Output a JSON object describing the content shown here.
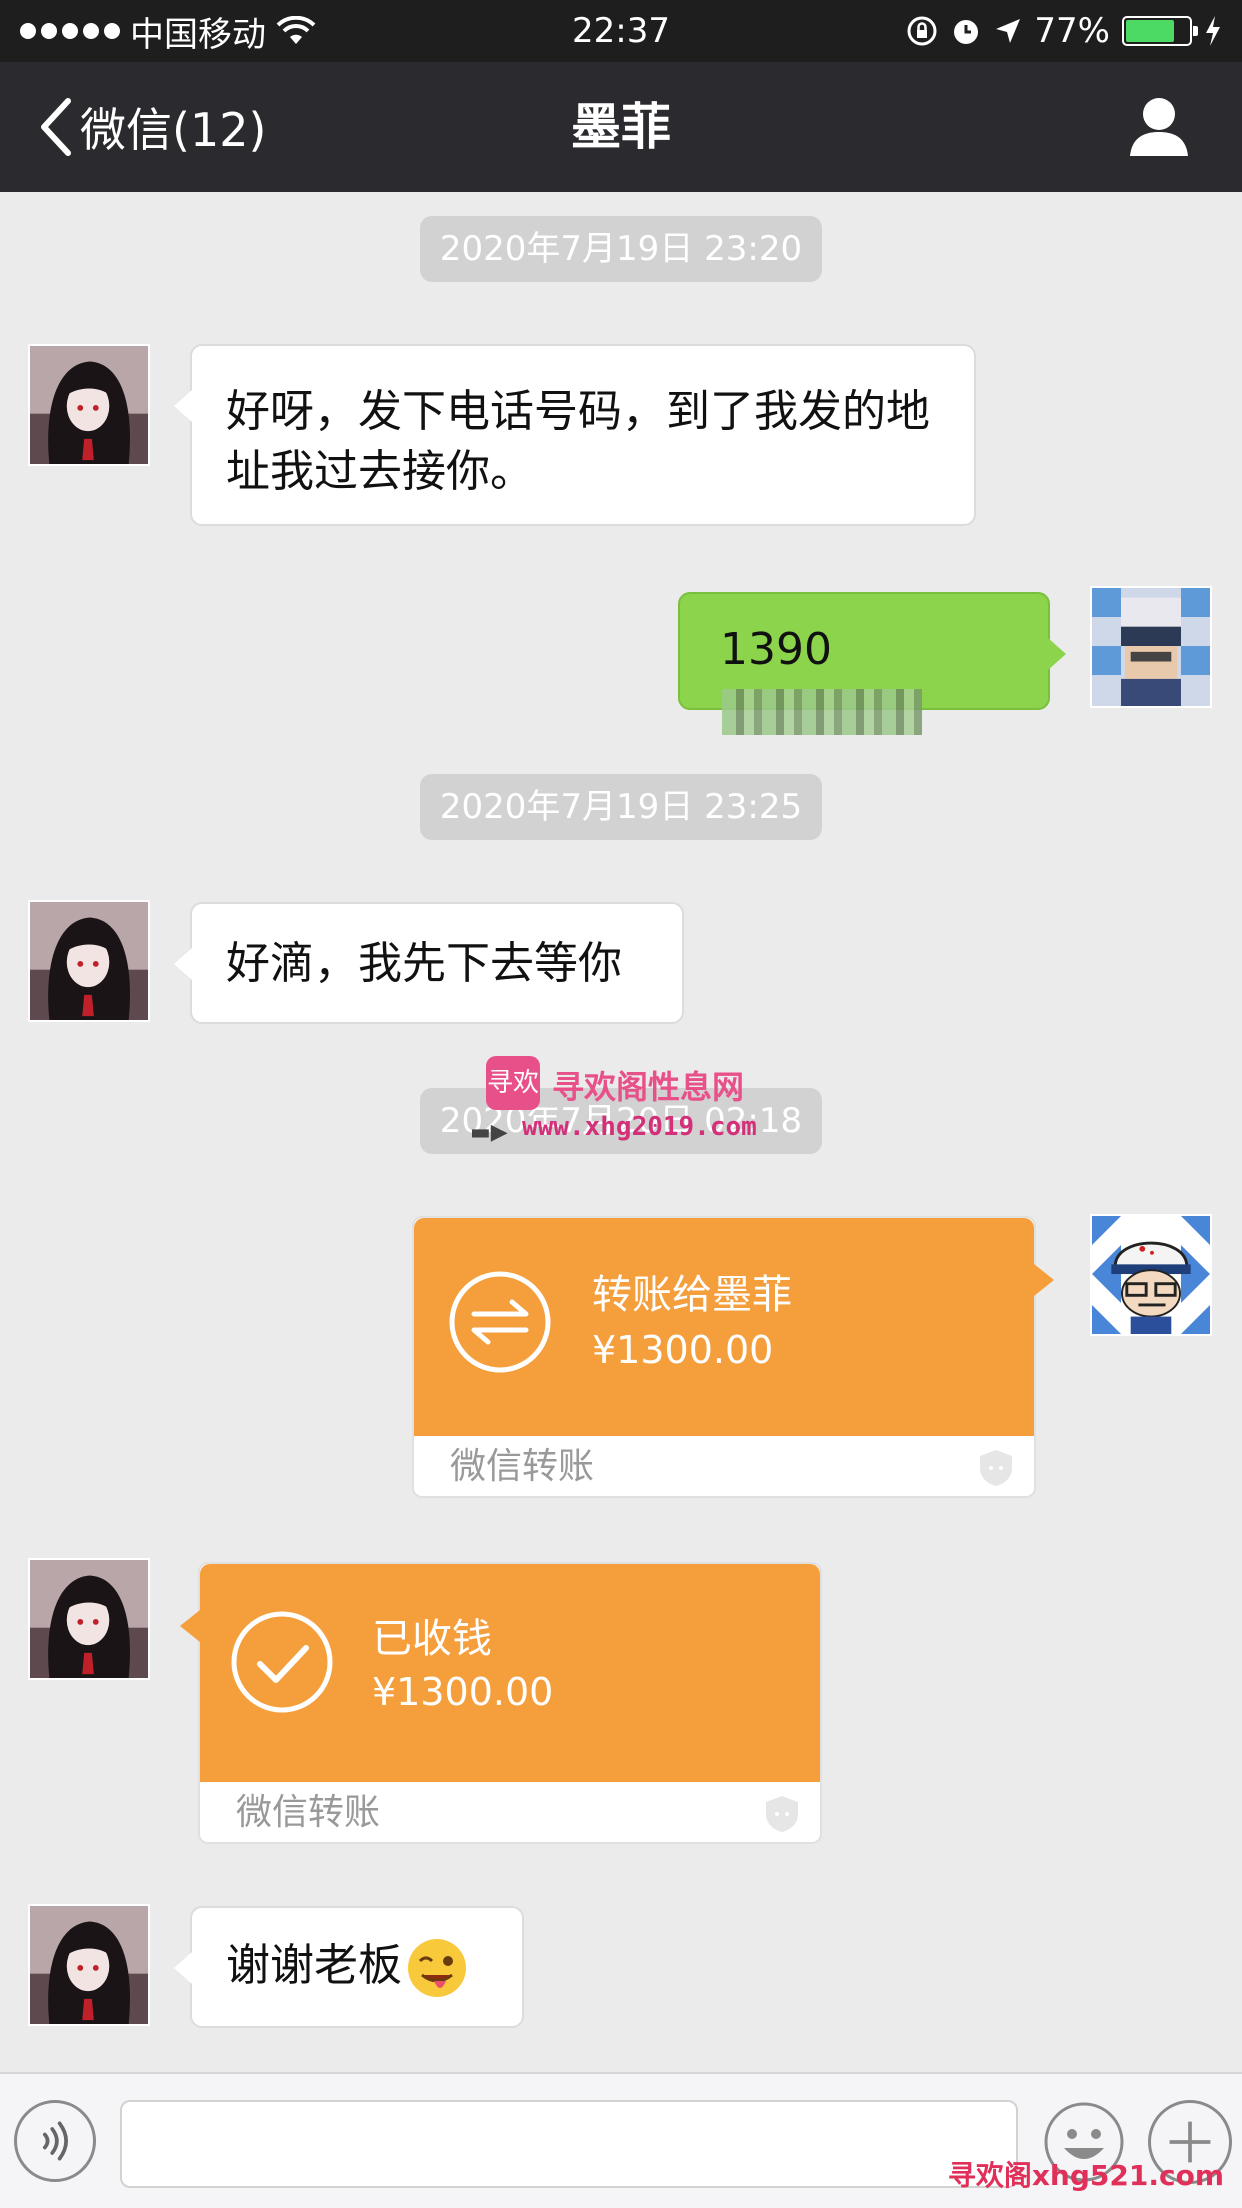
{
  "status_bar": {
    "carrier": "中国移动",
    "time": "22:37",
    "battery": "77%",
    "battery_level": 0.77
  },
  "nav": {
    "back_label": "微信(12)",
    "title": "墨菲"
  },
  "messages": {
    "time_1": "2020年7月19日 23:20",
    "msg_1": "好呀，发下电话号码，到了我发的地址我过去接你。",
    "msg_2_visible": "1390",
    "time_2": "2020年7月19日 23:25",
    "msg_3": "好滴，我先下去等你",
    "time_3": "2020年7月20日 02:18",
    "transfer_sent": {
      "title": "转账给墨菲",
      "amount": "¥1300.00",
      "footer": "微信转账"
    },
    "transfer_received": {
      "title": "已收钱",
      "amount": "¥1300.00",
      "footer": "微信转账"
    },
    "msg_4": "谢谢老板"
  },
  "watermark": {
    "site_name": "寻欢阁性息网",
    "site_url": "www.xhg2019.com",
    "logo_text": "寻欢",
    "corner_text": "寻欢阁xhg521.com"
  },
  "colors": {
    "nav_bg": "#2b2b2f",
    "chat_bg": "#ebebeb",
    "sent_bubble": "#8cd44c",
    "transfer_orange": "#f59e3c"
  },
  "icons": {
    "back": "chevron-left-icon",
    "profile": "person-icon",
    "transfer": "transfer-arrows-icon",
    "received": "checkmark-icon",
    "shield": "shield-icon",
    "voice": "voice-icon",
    "emoji": "smiley-icon",
    "plus": "plus-icon"
  }
}
